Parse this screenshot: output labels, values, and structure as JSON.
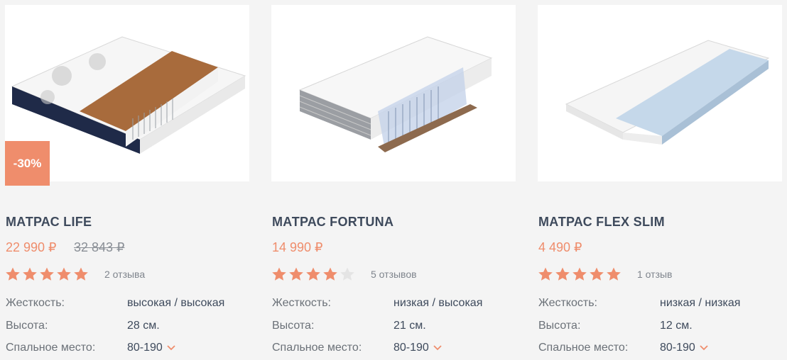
{
  "products": [
    {
      "title": "МАТРАС LIFE",
      "price": "22 990 ₽",
      "old_price": "32 843 ₽",
      "discount_badge": "-30%",
      "rating": 5,
      "reviews": "2 отзыва",
      "specs": [
        {
          "label": "Жесткость:",
          "value": "высокая / высокая"
        },
        {
          "label": "Высота:",
          "value": "28 см."
        },
        {
          "label": "Спальное место:",
          "value": "80-190"
        }
      ]
    },
    {
      "title": "МАТРАС FORTUNA",
      "price": "14 990 ₽",
      "rating": 4,
      "reviews": "5 отзывов",
      "specs": [
        {
          "label": "Жесткость:",
          "value": "низкая / высокая"
        },
        {
          "label": "Высота:",
          "value": "21 см."
        },
        {
          "label": "Спальное место:",
          "value": "80-190"
        }
      ]
    },
    {
      "title": "МАТРАС FLEX SLIM",
      "price": "4 490 ₽",
      "rating": 5,
      "reviews": "1 отзыв",
      "specs": [
        {
          "label": "Жесткость:",
          "value": "низкая / низкая"
        },
        {
          "label": "Высота:",
          "value": "12 см."
        },
        {
          "label": "Спальное место:",
          "value": "80-190"
        }
      ]
    }
  ],
  "colors": {
    "accent": "#ef8d6c",
    "title": "#3e4a5c",
    "star_empty": "#e4e4e4",
    "background": "#f4f4f4"
  },
  "icons": {
    "size_dropdown": "chevron-down-icon",
    "rating": "star-icon"
  }
}
